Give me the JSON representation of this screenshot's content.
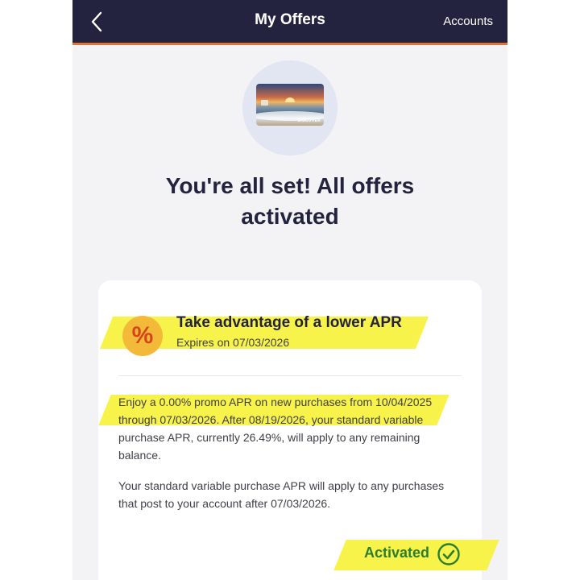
{
  "header": {
    "title": "My Offers",
    "accounts_label": "Accounts",
    "back_icon": "chevron-left-icon",
    "bar_color": "#23233f",
    "accent_color": "#e8712f"
  },
  "card_image": {
    "brand_text": "DISCOVER"
  },
  "confirmation": {
    "headline": "You're all set! All offers activated"
  },
  "offer": {
    "icon": "percent-icon",
    "title": "Take advantage of a lower APR",
    "expires": "Expires on 07/03/2026",
    "description_1": "Enjoy a 0.00% promo APR on new purchases from 10/04/2025 through 07/03/2026. After 08/19/2026, your standard variable purchase APR, currently 26.49%, will apply to any remaining balance.",
    "description_2": "Your standard variable purchase APR will apply to any purchases that post to your account after 07/03/2026.",
    "status": "Activated",
    "status_icon": "check-circle-icon",
    "status_color": "#2c7d31",
    "highlight_color": "#f8f241"
  }
}
